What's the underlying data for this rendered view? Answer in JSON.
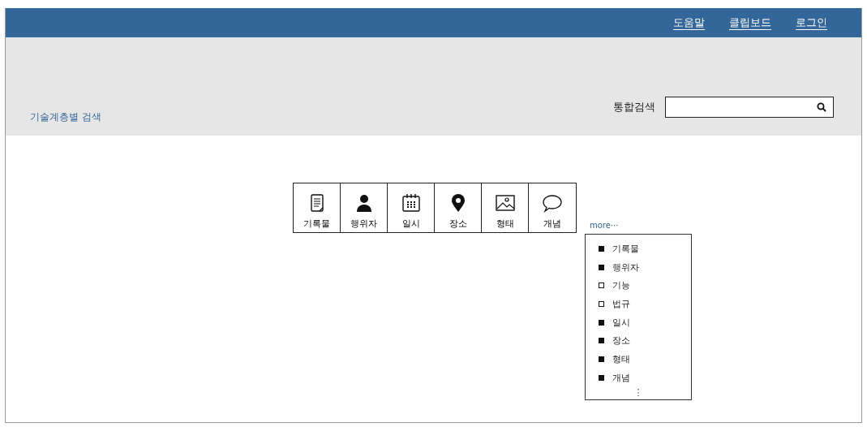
{
  "top_nav": {
    "links": [
      "도움말",
      "클립보드",
      "로그인"
    ]
  },
  "search_bar": {
    "category_link": "기술계층별 검색",
    "label": "통합검색"
  },
  "categories": [
    {
      "label": "기록물",
      "kind": "document"
    },
    {
      "label": "행위자",
      "kind": "person"
    },
    {
      "label": "일시",
      "kind": "calendar"
    },
    {
      "label": "장소",
      "kind": "pin"
    },
    {
      "label": "형태",
      "kind": "image"
    },
    {
      "label": "개념",
      "kind": "speech"
    }
  ],
  "more": {
    "label": "more···",
    "menu": [
      {
        "label": "기록물",
        "checked": true
      },
      {
        "label": "행위자",
        "checked": true
      },
      {
        "label": "기능",
        "checked": false
      },
      {
        "label": "법규",
        "checked": false
      },
      {
        "label": "일시",
        "checked": true
      },
      {
        "label": "장소",
        "checked": true
      },
      {
        "label": "형태",
        "checked": true
      },
      {
        "label": "개념",
        "checked": true
      }
    ],
    "ellipsis": "⋮"
  }
}
